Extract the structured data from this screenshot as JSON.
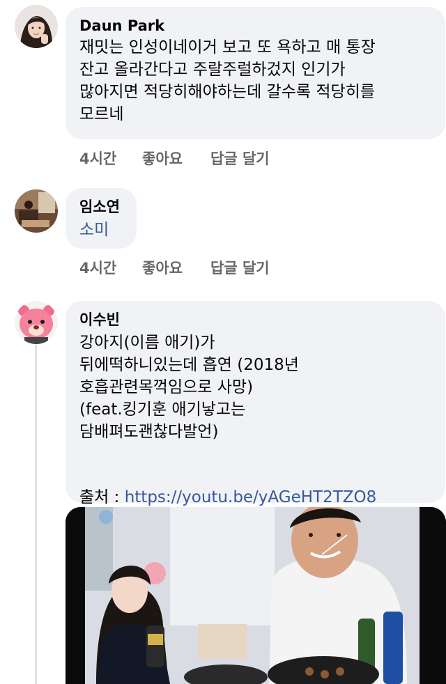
{
  "comments": [
    {
      "author": "Daun Park",
      "text": "재밋는 인성이네이거 보고 또 욕하고 매 통장\n잔고 올라간다고 주랄주럴하겄지 인기가\n많아지면 적당히해야하는데 갈수록 적당히를\n모르네",
      "time": "4시간",
      "like": "좋아요",
      "reply": "답글 달기"
    },
    {
      "author": "임소연",
      "mention": "소미",
      "time": "4시간",
      "like": "좋아요",
      "reply": "답글 달기"
    },
    {
      "author": "이수빈",
      "text": "강아지(이름 애기)가\n뒤에떡하니있는데 흡연  (2018년\n호흡관련목꺽임으로 사망)\n(feat.킹기훈 애기낳고는\n담배펴도괜찮다발언)",
      "source_label": "출처 : ",
      "source_link": "https://youtu.be/yAGeHT2TZO8"
    }
  ],
  "colors": {
    "bubble": "#f0f2f5",
    "link": "#385898",
    "meta": "#65676b",
    "text": "#050505"
  }
}
